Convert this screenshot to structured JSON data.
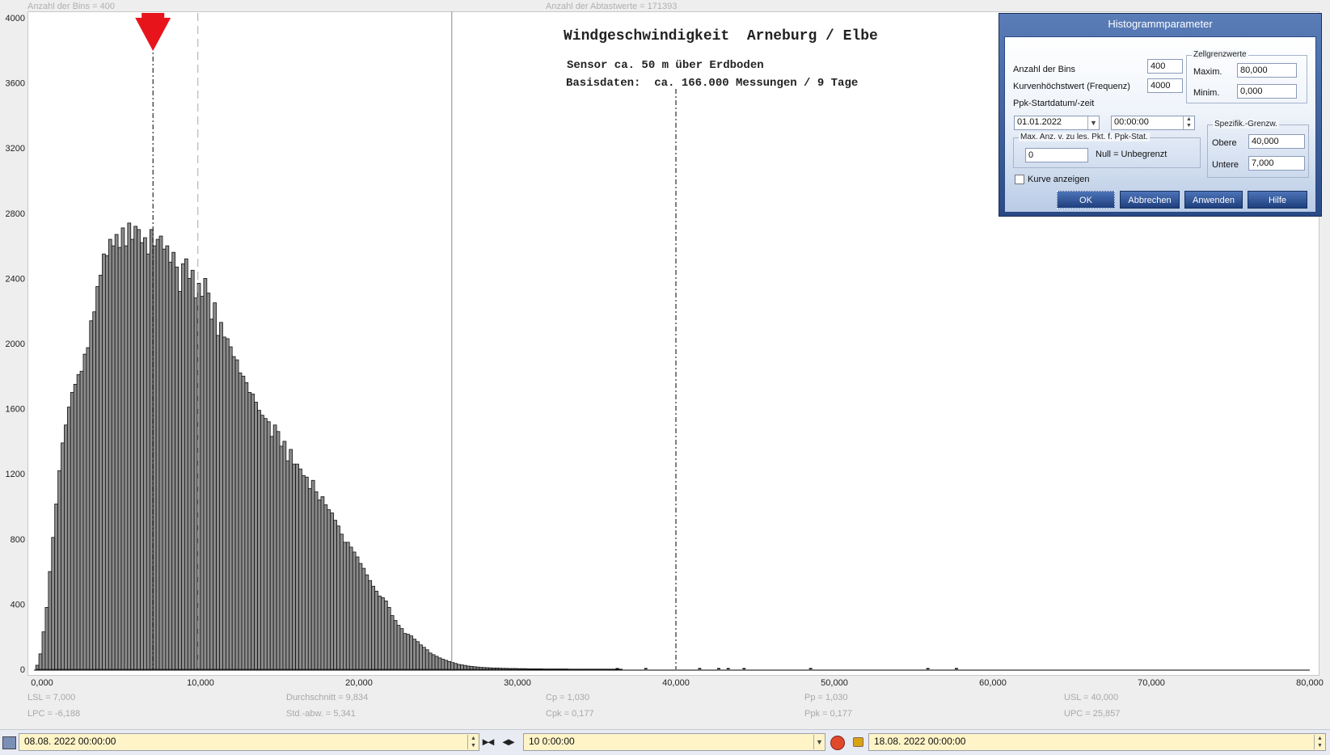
{
  "header": {
    "bins_label": "Anzahl der Bins =   400",
    "samples_label": "Anzahl der Abtastwerte = 171393"
  },
  "chart_titles": {
    "title": "Windgeschwindigkeit  Arneburg / Elbe",
    "sensor": "Sensor ca. 50 m über Erdboden",
    "basis": "Basisdaten:  ca. 166.000 Messungen / 9 Tage"
  },
  "stats": {
    "lsl": "LSL = 7,000",
    "lpc": "LPC = -6,188",
    "mean": "Durchschnitt  = 9,834",
    "std": "Std.-abw. = 5,341",
    "cp": "Cp  = 1,030",
    "cpk": "Cpk = 0,177",
    "pp": "Pp  = 1,030",
    "ppk": "Ppk = 0,177",
    "usl": "USL = 40,000",
    "upc": "UPC = 25,857"
  },
  "chart_data": {
    "type": "bar",
    "xlim": [
      0,
      80
    ],
    "ylim": [
      0,
      4000
    ],
    "x_ticks": [
      "0,000",
      "10,000",
      "20,000",
      "30,000",
      "40,000",
      "50,000",
      "60,000",
      "70,000",
      "80,000"
    ],
    "y_ticks": [
      "0",
      "400",
      "800",
      "1200",
      "1600",
      "2000",
      "2400",
      "2800",
      "3200",
      "3600",
      "4000"
    ],
    "bin_width": 0.2,
    "bin_start": -0.4,
    "values": [
      25,
      95,
      230,
      380,
      600,
      810,
      1015,
      1220,
      1390,
      1500,
      1610,
      1700,
      1750,
      1810,
      1830,
      1935,
      1975,
      2140,
      2195,
      2350,
      2420,
      2550,
      2540,
      2640,
      2600,
      2670,
      2590,
      2710,
      2600,
      2740,
      2640,
      2720,
      2700,
      2620,
      2650,
      2550,
      2700,
      2600,
      2640,
      2660,
      2580,
      2600,
      2500,
      2560,
      2470,
      2320,
      2490,
      2520,
      2400,
      2450,
      2280,
      2370,
      2290,
      2400,
      2310,
      2150,
      2250,
      2050,
      2130,
      2040,
      2030,
      1980,
      1920,
      1900,
      1820,
      1800,
      1760,
      1700,
      1690,
      1640,
      1590,
      1560,
      1540,
      1520,
      1430,
      1500,
      1460,
      1370,
      1400,
      1280,
      1350,
      1260,
      1260,
      1230,
      1190,
      1180,
      1110,
      1160,
      1090,
      1040,
      1060,
      1010,
      980,
      960,
      915,
      880,
      830,
      780,
      780,
      750,
      720,
      690,
      650,
      620,
      580,
      545,
      510,
      480,
      450,
      440,
      420,
      380,
      330,
      300,
      270,
      250,
      220,
      215,
      205,
      185,
      170,
      150,
      135,
      120,
      100,
      90,
      80,
      70,
      62,
      55,
      48,
      42,
      36,
      30,
      27,
      24,
      20,
      18,
      16,
      14,
      12,
      11,
      10,
      9,
      8,
      8,
      7,
      6,
      6,
      5,
      5,
      5,
      4,
      4,
      4,
      3,
      3,
      3,
      3,
      3,
      2,
      2,
      2,
      2,
      2,
      2,
      2,
      2,
      1,
      1,
      1,
      1,
      1,
      1,
      1,
      1,
      1,
      1,
      1,
      1,
      1,
      1,
      1,
      1,
      1
    ],
    "sparse_points": [
      [
        36.2,
        2
      ],
      [
        38.0,
        1
      ],
      [
        41.4,
        2
      ],
      [
        42.6,
        1
      ],
      [
        43.2,
        1
      ],
      [
        44.2,
        1
      ],
      [
        48.4,
        1
      ],
      [
        55.8,
        1
      ],
      [
        57.6,
        1
      ]
    ],
    "markers": {
      "lsl": 7.0,
      "mean": 9.834,
      "usl": 40.0,
      "upc": 25.857
    }
  },
  "dialog": {
    "title": "Histogrammparameter",
    "bins_label": "Anzahl der Bins",
    "bins_value": "400",
    "freq_label": "Kurvenhöchstwert (Frequenz)",
    "freq_value": "4000",
    "start_label": "Ppk-Startdatum/-zeit",
    "start_date": "01.01.2022",
    "start_time": "00:00:00",
    "cell_group": "Zellgrenzwerte",
    "max_label": "Maxim.",
    "max_value": "80,000",
    "min_label": "Minim.",
    "min_value": "0,000",
    "maxcount_group": "Max. Anz. v. zu les. Pkt. f. Ppk-Stat.",
    "maxcount_value": "0",
    "null_hint": "Null = Unbegrenzt",
    "spec_group": "Spezifik.-Grenzw.",
    "upper_label": "Obere",
    "upper_value": "40,000",
    "lower_label": "Untere",
    "lower_value": "7,000",
    "curve_label": "Kurve anzeigen",
    "ok": "OK",
    "cancel": "Abbrechen",
    "apply": "Anwenden",
    "help": "Hilfe"
  },
  "bottom_bar": {
    "start": "08.08. 2022   00:00:00",
    "span": "10  0:00:00",
    "end": "18.08. 2022   00:00:00"
  },
  "colors": {
    "bar_fill": "#8c8c8c",
    "bar_stroke": "#111111",
    "marker_red": "#e8141c",
    "dialog_blue": "#2a4a86"
  }
}
